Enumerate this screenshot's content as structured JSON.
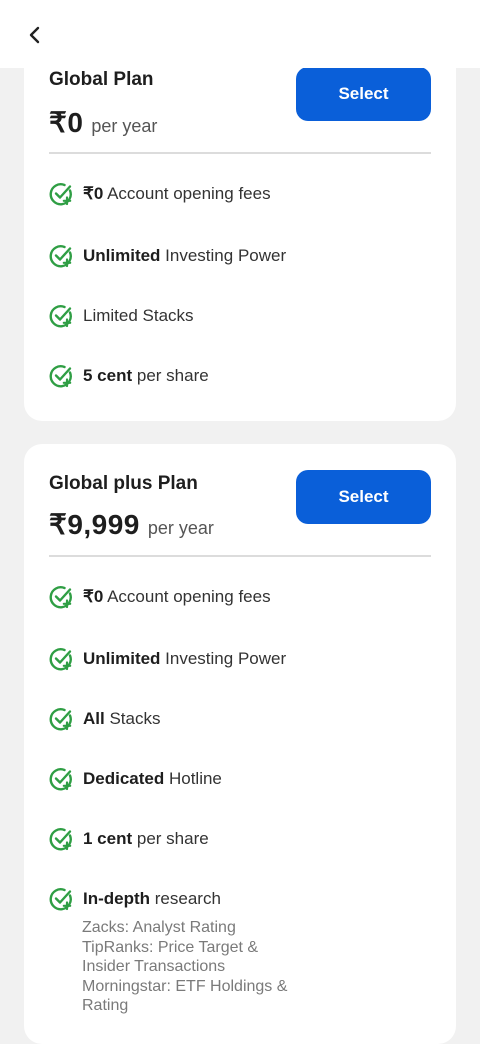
{
  "colors": {
    "accent": "#0a5fd9",
    "check": "#2f9e44",
    "background": "#f1f1f1"
  },
  "header": {
    "back_icon": "chevron-left-icon"
  },
  "plans": [
    {
      "name": "Global Plan",
      "price": "₹0",
      "period": "per year",
      "select_label": "Select",
      "features": [
        {
          "bold": "₹0",
          "rest": " Account opening fees"
        },
        {
          "bold": "Unlimited",
          "rest": " Investing Power"
        },
        {
          "bold": "",
          "rest": "Limited Stacks"
        },
        {
          "bold": "5 cent",
          "rest": " per share"
        }
      ]
    },
    {
      "name": "Global plus Plan",
      "price": "₹9,999",
      "period": "per year",
      "select_label": "Select",
      "features": [
        {
          "bold": "₹0",
          "rest": " Account opening fees"
        },
        {
          "bold": "Unlimited",
          "rest": " Investing Power"
        },
        {
          "bold": "All",
          "rest": " Stacks"
        },
        {
          "bold": "Dedicated",
          "rest": " Hotline"
        },
        {
          "bold": "1 cent",
          "rest": " per share"
        },
        {
          "bold": "In-depth",
          "rest": " research"
        }
      ],
      "research_sources": [
        "Zacks: Analyst Rating",
        "TipRanks: Price Target &",
        "Insider Transactions",
        "Morningstar: ETF Holdings &",
        "Rating"
      ]
    }
  ]
}
